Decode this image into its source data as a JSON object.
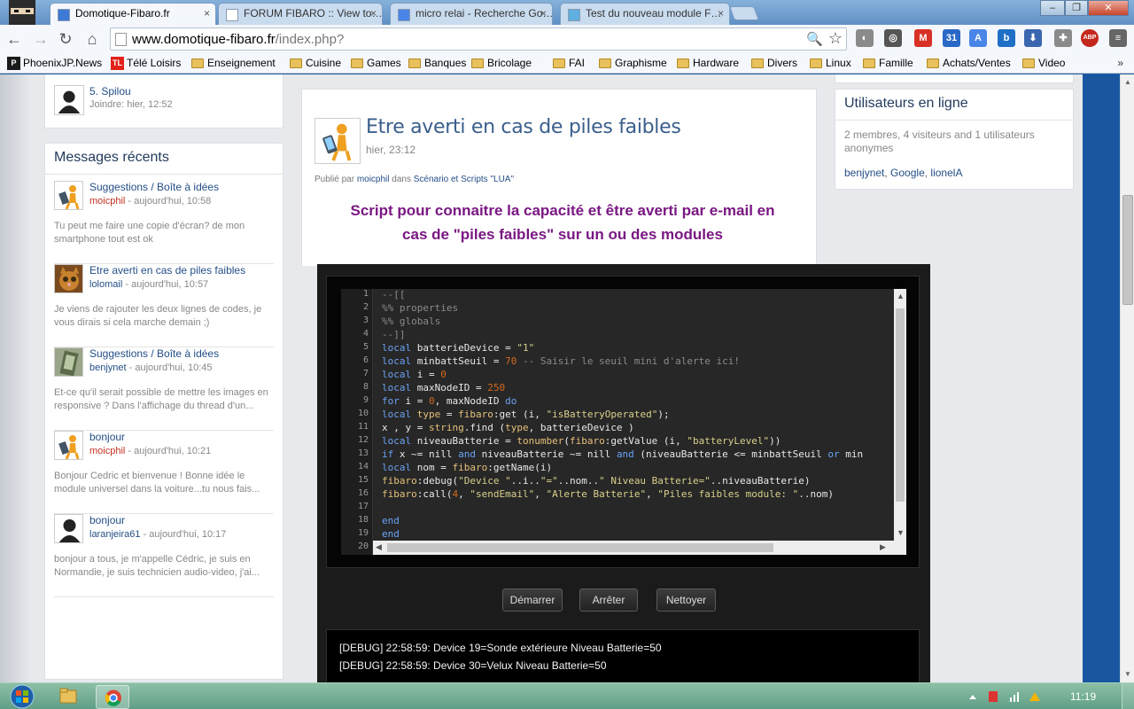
{
  "browser": {
    "tabs": [
      {
        "title": "Domotique-Fibaro.fr",
        "favicon": "fibaro-check-icon",
        "active": true
      },
      {
        "title": "FORUM FIBARO :: View to…",
        "favicon": "document-icon",
        "active": false
      },
      {
        "title": "micro relai - Recherche Go…",
        "favicon": "google-icon",
        "active": false
      },
      {
        "title": "Test du nouveau module F…",
        "favicon": "fibaro-ball-icon",
        "active": false
      }
    ],
    "close_glyph": "×",
    "url_host": "www.domotique-fibaro.fr",
    "url_path": "/index.php?",
    "window_minimize": "–",
    "window_maximize": "❐",
    "window_close": "✕",
    "nav_back": "←",
    "nav_forward": "→",
    "nav_reload": "↻",
    "nav_home": "⌂",
    "zoom_glyph": "🔍",
    "star_glyph": "☆",
    "extensions": [
      {
        "name": "globe-icon",
        "label": "◐",
        "color": "#8a8a8a"
      },
      {
        "name": "steering-icon",
        "label": "◎",
        "color": "#555555"
      },
      {
        "name": "gmail-icon",
        "label": "M",
        "color": "#d93025"
      },
      {
        "name": "calendar-icon",
        "label": "31",
        "color": "#2a68c8"
      },
      {
        "name": "translate-icon",
        "label": "A",
        "color": "#4a86e8"
      },
      {
        "name": "b-icon",
        "label": "b",
        "color": "#1f6fc6"
      },
      {
        "name": "download-icon",
        "label": "⬇",
        "color": "#3a66b0"
      },
      {
        "name": "puzzle-icon",
        "label": "✚",
        "color": "#8a8a8a"
      },
      {
        "name": "adblock-icon",
        "label": "ABP",
        "color": "#c4281c"
      },
      {
        "name": "wrench-icon",
        "label": "≡",
        "color": "#666666"
      }
    ],
    "bookmarks": [
      {
        "label": "PhoenixJP.News",
        "kind": "site",
        "badge": "P",
        "color": "#1a1a1a"
      },
      {
        "label": "Télé Loisirs",
        "kind": "site",
        "badge": "TL",
        "color": "#e2231a"
      },
      {
        "label": "Enseignement",
        "kind": "folder"
      },
      {
        "label": "Cuisine",
        "kind": "folder"
      },
      {
        "label": "Games",
        "kind": "folder"
      },
      {
        "label": "Banques",
        "kind": "folder"
      },
      {
        "label": "Bricolage",
        "kind": "folder"
      },
      {
        "label": "FAI",
        "kind": "folder"
      },
      {
        "label": "Graphisme",
        "kind": "folder"
      },
      {
        "label": "Hardware",
        "kind": "folder"
      },
      {
        "label": "Divers",
        "kind": "folder"
      },
      {
        "label": "Linux",
        "kind": "folder"
      },
      {
        "label": "Famille",
        "kind": "folder"
      },
      {
        "label": "Achats/Ventes",
        "kind": "folder"
      },
      {
        "label": "Video",
        "kind": "folder"
      }
    ],
    "bookmarks_more": "»"
  },
  "left_column": {
    "member": {
      "name": "5. Spilou",
      "joined": "Joindre: hier, 12:52"
    },
    "recent_title": "Messages récents",
    "messages": [
      {
        "title": "Suggestions / Boîte à idées",
        "user": "moicphil",
        "user_style": "red",
        "time": " - aujourd'hui, 10:58",
        "excerpt": "Tu peut me faire une copie d'écran? de mon smartphone tout est ok",
        "avatar": "orange-figure-avatar"
      },
      {
        "title": "Etre averti en cas de piles faibles",
        "user": "lolomail",
        "user_style": "dark",
        "time": " - aujourd'hui, 10:57",
        "excerpt": "Je viens de rajouter les deux lignes de codes, je vous dirais si cela marche demain ;)",
        "avatar": "cat-avatar"
      },
      {
        "title": "Suggestions / Boîte à idées",
        "user": "benjynet",
        "user_style": "dark",
        "time": " - aujourd'hui, 10:45",
        "excerpt": "Et-ce qu'il serait possible de mettre les images en responsive ? Dans l'affichage du thread d'un...",
        "avatar": "photo-avatar"
      },
      {
        "title": "bonjour",
        "user": "moicphil",
        "user_style": "red",
        "time": " - aujourd'hui, 10:21",
        "excerpt": "Bonjour Cedric et bienvenue ! Bonne idée le module universel dans la voiture...tu nous fais...",
        "avatar": "orange-figure-avatar"
      },
      {
        "title": "bonjour",
        "user": "laranjeira61",
        "user_style": "dark",
        "time": " - aujourd'hui, 10:17",
        "excerpt": "bonjour a tous, je m'appelle Cédric, je suis en Normandie, je suis technicien audio-video, j'ai...",
        "avatar": "default-user-avatar"
      }
    ]
  },
  "article": {
    "title": "Etre averti en cas de piles faibles",
    "date": "hier, 23:12",
    "byline_prefix": "Publié par ",
    "author": "moicphil",
    "byline_mid": " dans ",
    "category": "Scénario et Scripts \"LUA\"",
    "intro_line1": "Script pour connaitre la capacité et être averti par e-mail en",
    "intro_line2": "cas de \"piles faibles\" sur un ou des modules"
  },
  "code": {
    "lines": [
      "--[[",
      "%% properties",
      "%% globals",
      "--]]",
      "local batterieDevice = \"1\"",
      "local minbattSeuil = 70 -- Saisir le seuil mini d'alerte ici!",
      "local i = 0",
      "local maxNodeID = 250",
      "for i = 0, maxNodeID do",
      "local type = fibaro:get (i, \"isBatteryOperated\");",
      "x , y = string.find (type, batterieDevice )",
      "local niveauBatterie = tonumber(fibaro:getValue (i, \"batteryLevel\"))",
      "if x ~= nill and niveauBatterie ~= nill and (niveauBatterie <= minbattSeuil or min",
      "local nom = fibaro:getName(i)",
      "fibaro:debug(\"Device \"..i..\"=\"..nom..\" Niveau Batterie=\"..niveauBatterie)",
      "fibaro:call(4, \"sendEmail\", \"Alerte Batterie\", \"Piles faibles module: \"..nom)",
      "",
      "end",
      "end",
      ""
    ],
    "buttons": {
      "start": "Démarrer",
      "stop": "Arrêter",
      "clear": "Nettoyer"
    },
    "debug": [
      "[DEBUG] 22:58:59: Device 19=Sonde extérieure Niveau Batterie=50",
      "[DEBUG] 22:58:59: Device 30=Velux Niveau Batterie=50"
    ]
  },
  "right_column": {
    "title": "Utilisateurs en ligne",
    "stats": "2 membres, 4 visiteurs and 1 utilisateurs anonymes",
    "users": [
      "benjynet",
      "Google",
      "lionelA"
    ],
    "separator": ", "
  },
  "taskbar": {
    "clock": "11:19"
  }
}
